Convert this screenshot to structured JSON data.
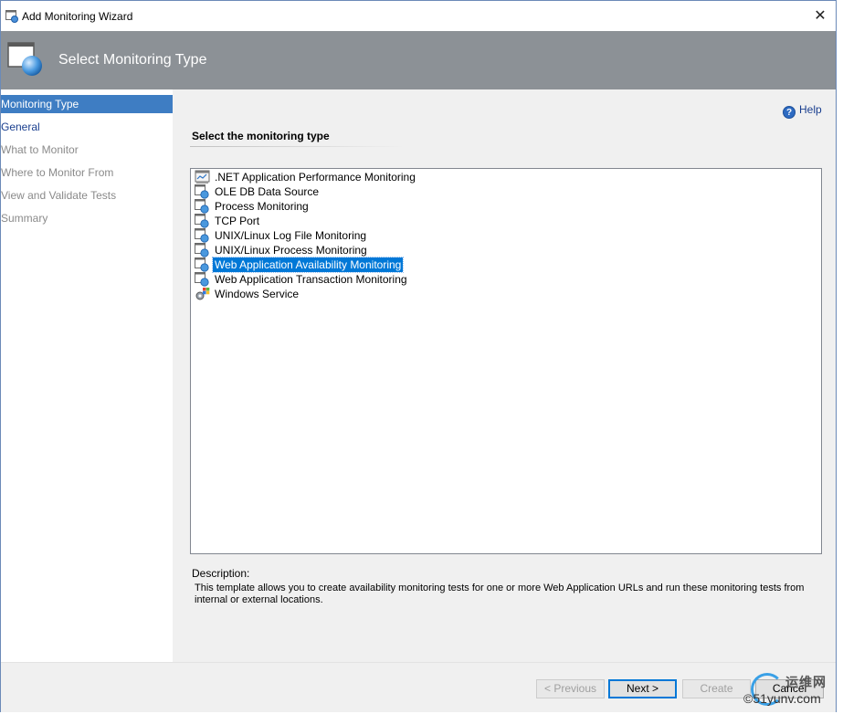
{
  "window": {
    "title": "Add Monitoring Wizard",
    "close_glyph": "✕"
  },
  "banner": {
    "title": "Select Monitoring Type",
    "icon": "monitoring-wizard-icon"
  },
  "nav": {
    "items": [
      {
        "label": "Monitoring Type",
        "state": "active"
      },
      {
        "label": "General",
        "state": "link"
      },
      {
        "label": "What to Monitor",
        "state": "disabled"
      },
      {
        "label": "Where to Monitor From",
        "state": "disabled"
      },
      {
        "label": "View and Validate Tests",
        "state": "disabled"
      },
      {
        "label": "Summary",
        "state": "disabled"
      }
    ]
  },
  "content": {
    "help_label": "Help",
    "help_icon": "help-icon",
    "section_title": "Select the monitoring type",
    "list": [
      {
        "label": ".NET Application Performance Monitoring",
        "icon": "dotnet-apm-icon",
        "selected": false
      },
      {
        "label": "OLE DB Data Source",
        "icon": "monitor-template-icon",
        "selected": false
      },
      {
        "label": "Process Monitoring",
        "icon": "monitor-template-icon",
        "selected": false
      },
      {
        "label": "TCP Port",
        "icon": "monitor-template-icon",
        "selected": false
      },
      {
        "label": "UNIX/Linux Log File Monitoring",
        "icon": "monitor-template-icon",
        "selected": false
      },
      {
        "label": "UNIX/Linux Process Monitoring",
        "icon": "monitor-template-icon",
        "selected": false
      },
      {
        "label": "Web Application Availability Monitoring",
        "icon": "monitor-template-icon",
        "selected": true
      },
      {
        "label": "Web Application Transaction Monitoring",
        "icon": "monitor-template-icon",
        "selected": false
      },
      {
        "label": "Windows Service",
        "icon": "windows-service-icon",
        "selected": false
      }
    ],
    "description_label": "Description:",
    "description_text": "This template allows you to create availability monitoring tests for one or more Web Application URLs and run these monitoring tests from internal or external locations."
  },
  "footer": {
    "previous_label": "< Previous",
    "next_label": "Next >",
    "create_label": "Create",
    "cancel_label": "Cancel"
  },
  "watermark": {
    "cn_text": "运维网",
    "text": "©51yunv.com"
  },
  "colors": {
    "banner": "#8c9196",
    "nav_active": "#3e7dc3",
    "selection": "#0078d7",
    "link": "#1a3f8f"
  }
}
